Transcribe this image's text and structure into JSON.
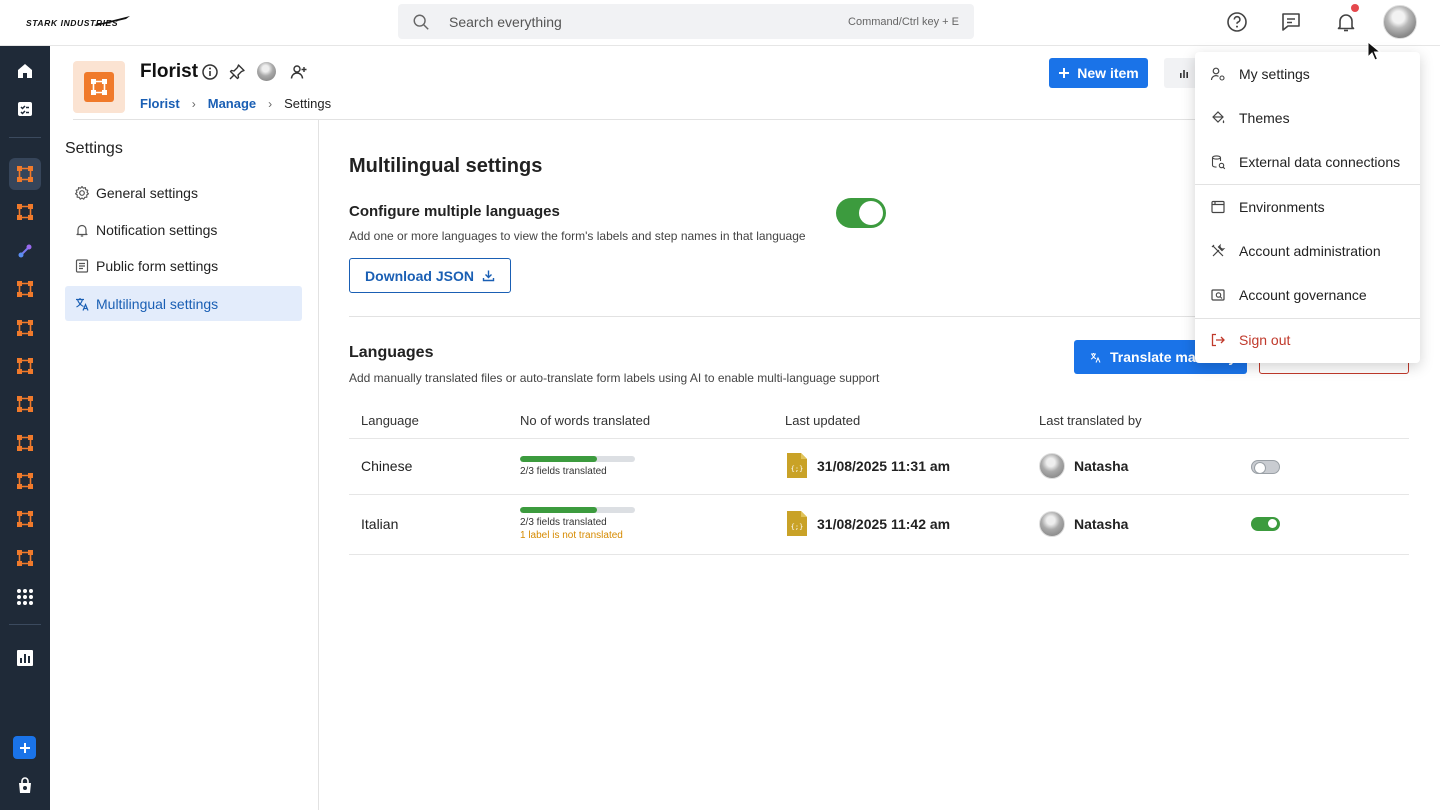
{
  "brand": {
    "name": "STARK INDUSTRIES"
  },
  "search": {
    "placeholder": "Search everything",
    "hint": "Command/Ctrl key + E"
  },
  "app": {
    "title": "Florist",
    "tile_color": "#f07a2b",
    "tile_bg": "#fbe3d2"
  },
  "breadcrumb": [
    {
      "label": "Florist"
    },
    {
      "label": "Manage"
    },
    {
      "label": "Settings"
    }
  ],
  "header_actions": {
    "new_item": "New item"
  },
  "settings_nav": {
    "title": "Settings",
    "items": [
      {
        "label": "General settings",
        "icon": "gear-icon"
      },
      {
        "label": "Notification settings",
        "icon": "bell-icon"
      },
      {
        "label": "Public form settings",
        "icon": "form-icon"
      },
      {
        "label": "Multilingual settings",
        "icon": "translate-icon",
        "active": true
      }
    ]
  },
  "main": {
    "title": "Multilingual settings",
    "configure": {
      "title": "Configure multiple languages",
      "description": "Add one or more languages to view the form's labels and step names in that language",
      "enabled": true
    },
    "download_button": "Download JSON",
    "languages": {
      "title": "Languages",
      "description": "Add manually translated files or auto-translate form labels using AI to enable multi-language support",
      "translate_button": "Translate manually",
      "columns": [
        "Language",
        "No of words translated",
        "Last updated",
        "Last translated by"
      ],
      "rows": [
        {
          "language": "Chinese",
          "progress": 0.67,
          "progress_text": "2/3 fields translated",
          "warning": "",
          "updated": "31/08/2025 11:31 am",
          "user": "Natasha",
          "enabled": false
        },
        {
          "language": "Italian",
          "progress": 0.67,
          "progress_text": "2/3 fields translated",
          "warning": "1 label is not translated",
          "updated": "31/08/2025 11:42 am",
          "user": "Natasha",
          "enabled": true
        }
      ]
    }
  },
  "account_menu": {
    "items": [
      {
        "label": "My settings",
        "icon": "user-settings-icon"
      },
      {
        "label": "Themes",
        "icon": "paint-bucket-icon"
      },
      {
        "label": "External data connections",
        "icon": "database-icon"
      },
      {
        "label": "Environments",
        "icon": "window-icon"
      },
      {
        "label": "Account administration",
        "icon": "tools-icon"
      },
      {
        "label": "Account governance",
        "icon": "governance-icon"
      },
      {
        "label": "Sign out",
        "icon": "sign-out-icon"
      }
    ]
  },
  "colors": {
    "accent": "#1a73e8",
    "link": "#1a5fb4",
    "success": "#3c9b3e",
    "danger": "#c0392b",
    "rail": "#1f2a38"
  }
}
